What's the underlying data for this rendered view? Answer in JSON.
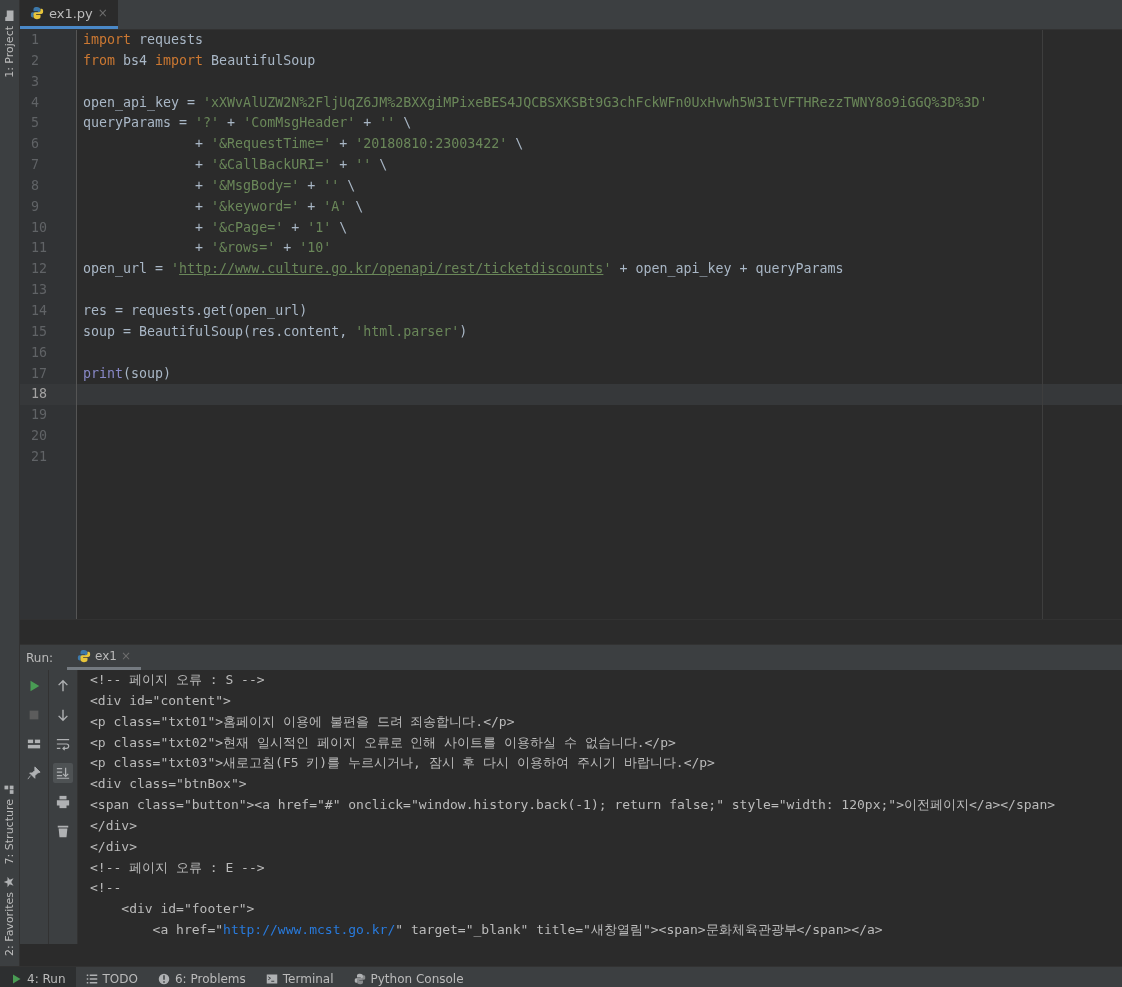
{
  "left_stripe": [
    {
      "label": "1: Project"
    },
    {
      "label": "7: Structure"
    },
    {
      "label": "2: Favorites"
    }
  ],
  "editor_tabs": [
    {
      "label": "ex1.py",
      "close": "×",
      "selected": true
    }
  ],
  "code_lines": [
    {
      "number": "1",
      "current": false,
      "tokens": [
        {
          "kind": "keyword",
          "text": "import"
        },
        {
          "kind": "plain",
          "text": " requests"
        }
      ]
    },
    {
      "number": "2",
      "current": false,
      "tokens": [
        {
          "kind": "keyword",
          "text": "from"
        },
        {
          "kind": "plain",
          "text": " bs4 "
        },
        {
          "kind": "keyword",
          "text": "import"
        },
        {
          "kind": "plain",
          "text": " BeautifulSoup"
        }
      ]
    },
    {
      "number": "3",
      "current": false
    },
    {
      "number": "4",
      "current": false,
      "tokens": [
        {
          "kind": "plain",
          "text": "open_api_key = "
        },
        {
          "kind": "string",
          "text": "'xXWvAlUZW2N%2FljUqZ6JM%2BXXgiMPixeBES4JQCBSXKSBt9G3chFckWFn0UxHvwh5W3ItVFTHRezzTWNY8o9iGGQ%3D%3D'"
        }
      ]
    },
    {
      "number": "5",
      "current": false,
      "tokens": [
        {
          "kind": "plain",
          "text": "queryParams = "
        },
        {
          "kind": "string",
          "text": "'?'"
        },
        {
          "kind": "plain",
          "text": " + "
        },
        {
          "kind": "string",
          "text": "'ComMsgHeader'"
        },
        {
          "kind": "plain",
          "text": " + "
        },
        {
          "kind": "string",
          "text": "''"
        },
        {
          "kind": "plain",
          "text": " \\"
        }
      ]
    },
    {
      "number": "6",
      "current": false,
      "tokens": [
        {
          "kind": "plain",
          "text": "              + "
        },
        {
          "kind": "string",
          "text": "'&RequestTime='"
        },
        {
          "kind": "plain",
          "text": " + "
        },
        {
          "kind": "string",
          "text": "'20180810:23003422'"
        },
        {
          "kind": "plain",
          "text": " \\"
        }
      ]
    },
    {
      "number": "7",
      "current": false,
      "tokens": [
        {
          "kind": "plain",
          "text": "              + "
        },
        {
          "kind": "string",
          "text": "'&CallBackURI='"
        },
        {
          "kind": "plain",
          "text": " + "
        },
        {
          "kind": "string",
          "text": "''"
        },
        {
          "kind": "plain",
          "text": " \\"
        }
      ]
    },
    {
      "number": "8",
      "current": false,
      "tokens": [
        {
          "kind": "plain",
          "text": "              + "
        },
        {
          "kind": "string",
          "text": "'&MsgBody='"
        },
        {
          "kind": "plain",
          "text": " + "
        },
        {
          "kind": "string",
          "text": "''"
        },
        {
          "kind": "plain",
          "text": " \\"
        }
      ]
    },
    {
      "number": "9",
      "current": false,
      "tokens": [
        {
          "kind": "plain",
          "text": "              + "
        },
        {
          "kind": "string",
          "text": "'&keyword='"
        },
        {
          "kind": "plain",
          "text": " + "
        },
        {
          "kind": "string",
          "text": "'A'"
        },
        {
          "kind": "plain",
          "text": " \\"
        }
      ]
    },
    {
      "number": "10",
      "current": false,
      "tokens": [
        {
          "kind": "plain",
          "text": "              + "
        },
        {
          "kind": "string",
          "text": "'&cPage='"
        },
        {
          "kind": "plain",
          "text": " + "
        },
        {
          "kind": "string",
          "text": "'1'"
        },
        {
          "kind": "plain",
          "text": " \\"
        }
      ]
    },
    {
      "number": "11",
      "current": false,
      "tokens": [
        {
          "kind": "plain",
          "text": "              + "
        },
        {
          "kind": "string",
          "text": "'&rows='"
        },
        {
          "kind": "plain",
          "text": " + "
        },
        {
          "kind": "string",
          "text": "'10'"
        }
      ]
    },
    {
      "number": "12",
      "current": false,
      "tokens": [
        {
          "kind": "plain",
          "text": "open_url = "
        },
        {
          "kind": "string",
          "text": "'"
        },
        {
          "kind": "link",
          "text": "http://www.culture.go.kr/openapi/rest/ticketdiscounts"
        },
        {
          "kind": "string",
          "text": "'"
        },
        {
          "kind": "plain",
          "text": " + open_api_key + queryParams"
        }
      ]
    },
    {
      "number": "13",
      "current": false
    },
    {
      "number": "14",
      "current": false,
      "tokens": [
        {
          "kind": "plain",
          "text": "res = requests.get(open_url)"
        }
      ]
    },
    {
      "number": "15",
      "current": false,
      "tokens": [
        {
          "kind": "plain",
          "text": "soup = BeautifulSoup(res.content, "
        },
        {
          "kind": "string",
          "text": "'html.parser'"
        },
        {
          "kind": "plain",
          "text": ")"
        }
      ]
    },
    {
      "number": "16",
      "current": false
    },
    {
      "number": "17",
      "current": false,
      "tokens": [
        {
          "kind": "builtin",
          "text": "print"
        },
        {
          "kind": "plain",
          "text": "(soup)"
        }
      ]
    },
    {
      "number": "18",
      "current": true
    },
    {
      "number": "19",
      "current": false
    },
    {
      "number": "20",
      "current": false
    },
    {
      "number": "21",
      "current": false
    }
  ],
  "run_panel": {
    "label": "Run:",
    "tabs": [
      {
        "label": "ex1",
        "close": "×",
        "selected": true
      }
    ],
    "output_lines": [
      [
        {
          "kind": "plain",
          "text": "<!-- 페이지 오류 : S -->"
        }
      ],
      [
        {
          "kind": "plain",
          "text": "<div id=\"content\">"
        }
      ],
      [
        {
          "kind": "plain",
          "text": "<p class=\"txt01\">홈페이지 이용에 불편을 드려 죄송합니다.</p>"
        }
      ],
      [
        {
          "kind": "plain",
          "text": "<p class=\"txt02\">현재 일시적인 페이지 오류로 인해 사이트를 이용하실 수 없습니다.</p>"
        }
      ],
      [
        {
          "kind": "plain",
          "text": "<p class=\"txt03\">새로고침(F5 키)를 누르시거나, 잠시 후 다시 이용하여 주시기 바랍니다.</p>"
        }
      ],
      [
        {
          "kind": "plain",
          "text": "<div class=\"btnBox\">"
        }
      ],
      [
        {
          "kind": "plain",
          "text": "<span class=\"button\"><a href=\"#\" onclick=\"window.history.back(-1); return false;\" style=\"width: 120px;\">이전페이지</a></span>"
        }
      ],
      [
        {
          "kind": "plain",
          "text": "</div>"
        }
      ],
      [
        {
          "kind": "plain",
          "text": "</div>"
        }
      ],
      [
        {
          "kind": "plain",
          "text": "<!-- 페이지 오류 : E -->"
        }
      ],
      [
        {
          "kind": "plain",
          "text": "<!--"
        }
      ],
      [
        {
          "kind": "plain",
          "text": "    <div id=\"footer\">"
        }
      ],
      [
        {
          "kind": "plain",
          "text": "        <a href=\""
        },
        {
          "kind": "link",
          "text": "http://www.mcst.go.kr/"
        },
        {
          "kind": "plain",
          "text": "\" target=\"_blank\" title=\"새창열림\"><span>문화체육관광부</span></a>"
        }
      ]
    ],
    "output_tools": [
      {
        "selected": false
      },
      {
        "selected": false
      },
      {
        "selected": false
      },
      {
        "selected": true
      },
      {
        "selected": false
      },
      {
        "selected": false
      }
    ]
  },
  "bottom_tabs": [
    {
      "label": "4: Run",
      "selected": true
    },
    {
      "label": "TODO",
      "selected": false
    },
    {
      "label": "6: Problems",
      "selected": false
    },
    {
      "label": "Terminal",
      "selected": false
    },
    {
      "label": "Python Console",
      "selected": false
    }
  ]
}
